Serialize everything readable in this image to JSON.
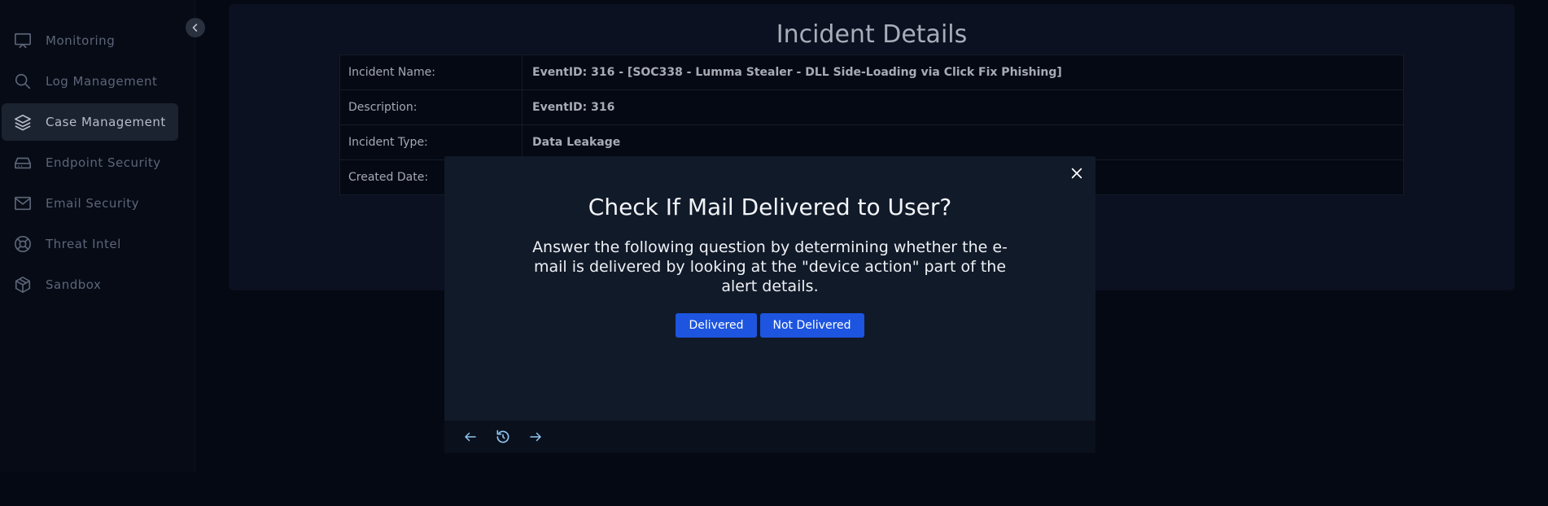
{
  "sidebar": {
    "items": [
      {
        "label": "Monitoring",
        "icon": "monitor-icon",
        "active": false
      },
      {
        "label": "Log Management",
        "icon": "search-icon",
        "active": false
      },
      {
        "label": "Case Management",
        "icon": "layers-icon",
        "active": true
      },
      {
        "label": "Endpoint Security",
        "icon": "drive-icon",
        "active": false
      },
      {
        "label": "Email Security",
        "icon": "mail-icon",
        "active": false
      },
      {
        "label": "Threat Intel",
        "icon": "lifebuoy-icon",
        "active": false
      },
      {
        "label": "Sandbox",
        "icon": "box-icon",
        "active": false
      }
    ],
    "collapse_icon": "chevron-left-icon"
  },
  "main": {
    "title": "Incident Details",
    "rows": [
      {
        "key": "Incident Name:",
        "value": "EventID: 316 - [SOC338 - Lumma Stealer - DLL Side-Loading via Click Fix Phishing]"
      },
      {
        "key": "Description:",
        "value": "EventID: 316"
      },
      {
        "key": "Incident Type:",
        "value": "Data Leakage"
      },
      {
        "key": "Created Date:",
        "value": ""
      }
    ]
  },
  "modal": {
    "title": "Check If Mail Delivered to User?",
    "text": "Answer the following question by determining whether the e-mail is delivered by looking at the \"device action\" part of the alert details.",
    "buttons": {
      "delivered": "Delivered",
      "not_delivered": "Not Delivered"
    },
    "footer_icons": [
      "arrow-left-icon",
      "restart-icon",
      "arrow-right-icon"
    ],
    "close_icon": "close-icon"
  },
  "colors": {
    "background": "#050913",
    "panel": "#0b1120",
    "modal": "#111a29",
    "accent_button": "#1d55e0"
  }
}
